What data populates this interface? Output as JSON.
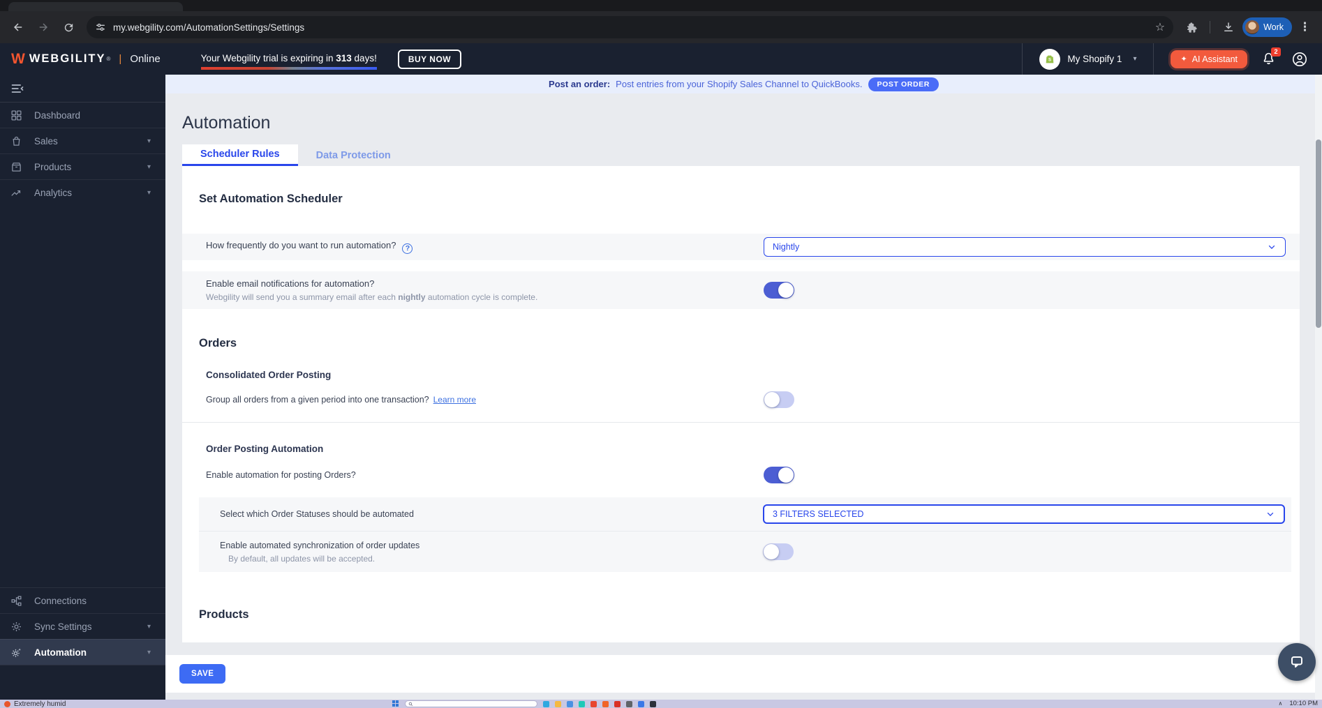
{
  "browser": {
    "url": "my.webgility.com/AutomationSettings/Settings",
    "profile_label": "Work"
  },
  "glyphs": {
    "star": "☆",
    "dots": "⋮",
    "caret": "▾",
    "sparkle": "✦",
    "question": "?"
  },
  "header": {
    "brand": "WEBGILITY",
    "reg": "®",
    "separator": "|",
    "mode": "Online",
    "trial_prefix": "Your Webgility trial is expiring in ",
    "trial_days": "313",
    "trial_suffix": " days!",
    "buy_now_label": "BUY NOW",
    "store_name": "My Shopify 1",
    "ai_assistant_label": "AI Assistant",
    "notification_count": "2"
  },
  "banner": {
    "lead": "Post an order:",
    "message": "Post entries from your Shopify Sales Channel to QuickBooks.",
    "button_label": "POST ORDER"
  },
  "sidebar": {
    "items": [
      {
        "label": "Dashboard"
      },
      {
        "label": "Sales"
      },
      {
        "label": "Products"
      },
      {
        "label": "Analytics"
      }
    ],
    "bottom_items": [
      {
        "label": "Connections"
      },
      {
        "label": "Sync Settings"
      },
      {
        "label": "Automation"
      }
    ]
  },
  "page": {
    "title": "Automation",
    "tabs": [
      {
        "label": "Scheduler Rules"
      },
      {
        "label": "Data Protection"
      }
    ],
    "save_label": "SAVE"
  },
  "scheduler": {
    "heading": "Set Automation Scheduler",
    "frequency_label": "How frequently do you want to run automation?",
    "frequency_value": "Nightly",
    "email_label": "Enable email notifications for automation?",
    "email_note_prefix": "Webgility will send you a summary email after each ",
    "email_note_bold": "nightly",
    "email_note_suffix": " automation cycle is complete."
  },
  "orders": {
    "heading": "Orders",
    "consolidated_heading": "Consolidated Order Posting",
    "consolidated_label": "Group all orders from a given period into one transaction?",
    "learn_more_label": "Learn more",
    "posting_heading": "Order Posting Automation",
    "posting_label": "Enable automation for posting Orders?",
    "statuses_label": "Select which Order Statuses should be automated",
    "statuses_value": "3 FILTERS SELECTED",
    "sync_label": "Enable automated synchronization of order updates",
    "sync_note": "By default, all updates will be accepted."
  },
  "products_section": {
    "heading": "Products"
  },
  "toggles": {
    "email": true,
    "consolidated": false,
    "posting": true,
    "order_sync": false
  },
  "taskbar": {
    "weather": "Extremely humid",
    "time": "10:10 PM"
  },
  "colors": {
    "accent_blue": "#2946eb",
    "brand_orange": "#f4552f",
    "toggle_on": "#4c5ed3",
    "banner_bg": "#e8eefc"
  }
}
